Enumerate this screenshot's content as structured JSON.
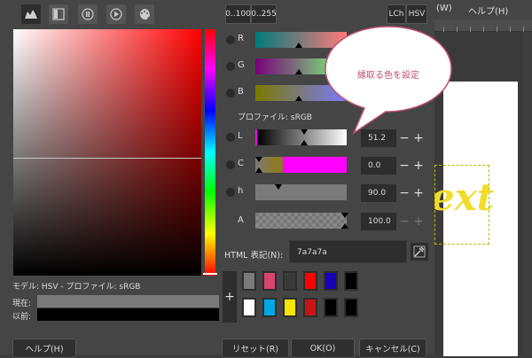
{
  "app_menu": {
    "item1": "(W)",
    "item2": "ヘルプ(H)"
  },
  "canvas_text": "ext",
  "tabs": [
    {
      "name": "gimp-selector-tab",
      "icon": "gimp-icon"
    },
    {
      "name": "cmyk-selector-tab",
      "icon": "cmyk-icon"
    },
    {
      "name": "watercolor-selector-tab",
      "icon": "watercolor-icon"
    },
    {
      "name": "wheel-selector-tab",
      "icon": "wheel-icon"
    },
    {
      "name": "palette-selector-tab",
      "icon": "palette-icon"
    }
  ],
  "scale_buttons": {
    "a": "0..100",
    "b": "0..255"
  },
  "model_buttons": {
    "lch": "LCh",
    "hsv": "HSV"
  },
  "channels": {
    "r": {
      "label": "R"
    },
    "g": {
      "label": "G"
    },
    "b": {
      "label": "B"
    },
    "profile": "プロファイル: sRGB",
    "l": {
      "label": "L",
      "value": "51.2"
    },
    "c": {
      "label": "C",
      "value": "0.0"
    },
    "h": {
      "label": "h",
      "value": "90.0"
    },
    "a": {
      "label": "A",
      "value": "100.0"
    }
  },
  "html": {
    "label": "HTML 表記(N):",
    "value": "7a7a7a"
  },
  "model_info": "モデル: HSV - プロファイル: sRGB",
  "current_label": "現在:",
  "previous_label": "以前:",
  "colors": {
    "current": "#7a7a7a",
    "previous": "#000000"
  },
  "history": [
    "#7a7a7a",
    "#d9456e",
    "#3a3a3a",
    "#ff0000",
    "#1800b8",
    "#000000",
    "#ffffff",
    "#00a8e8",
    "#f5e600",
    "#c81414",
    "#000000",
    "#000000"
  ],
  "buttons": {
    "help": "ヘルプ(H)",
    "reset": "リセット(R)",
    "ok": "OK(O)",
    "cancel": "キャンセル(C)"
  },
  "callout": "縁取る色を設定"
}
